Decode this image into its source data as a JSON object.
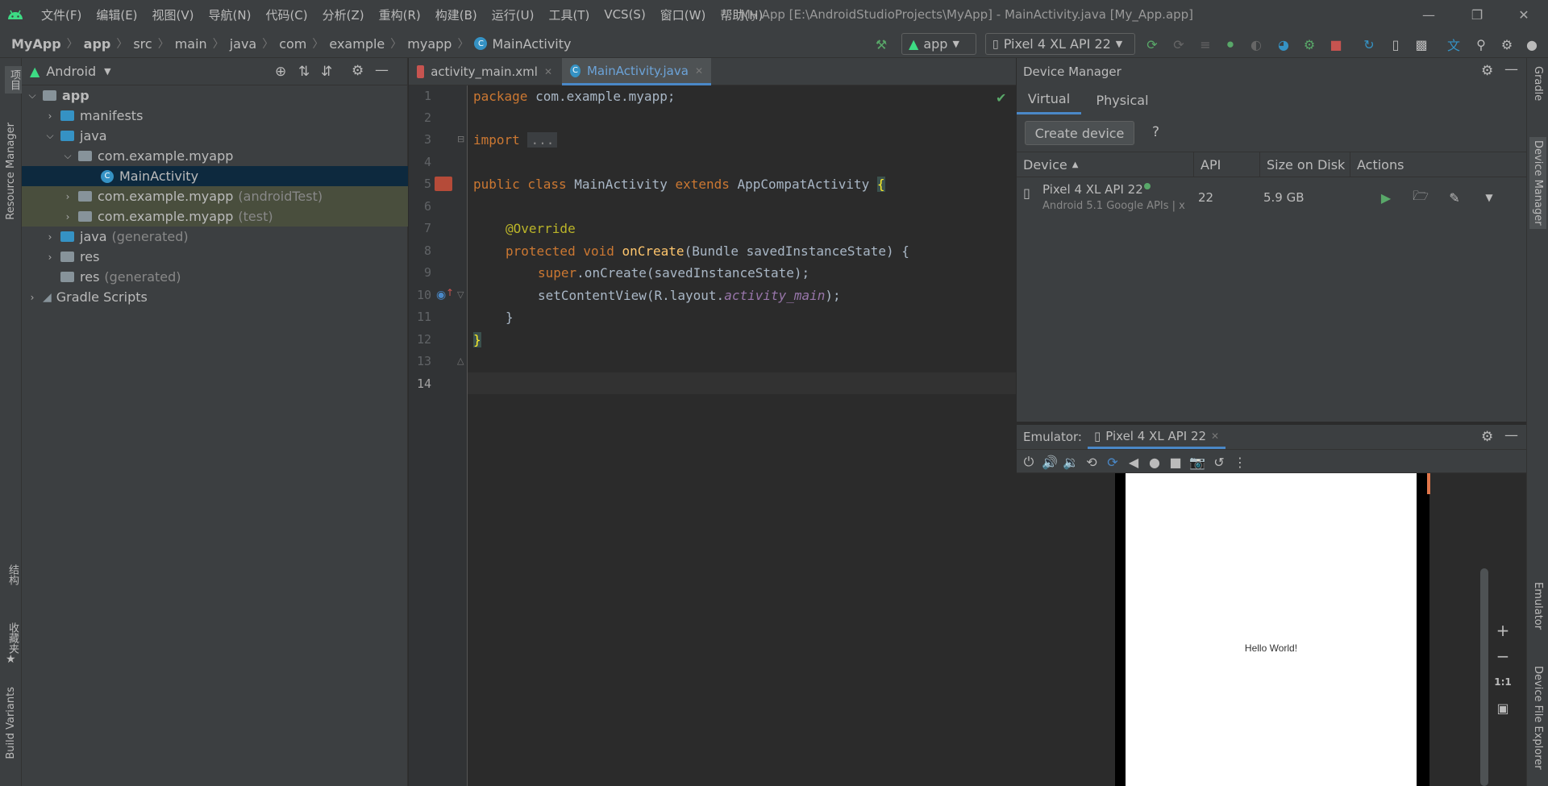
{
  "window": {
    "title": "My App [E:\\AndroidStudioProjects\\MyApp] - MainActivity.java [My_App.app]",
    "menu": [
      "文件(F)",
      "编辑(E)",
      "视图(V)",
      "导航(N)",
      "代码(C)",
      "分析(Z)",
      "重构(R)",
      "构建(B)",
      "运行(U)",
      "工具(T)",
      "VCS(S)",
      "窗口(W)",
      "帮助(H)"
    ]
  },
  "breadcrumbs": [
    "MyApp",
    "app",
    "src",
    "main",
    "java",
    "com",
    "example",
    "myapp",
    "MainActivity"
  ],
  "toolbar": {
    "run_config": "app",
    "device": "Pixel 4 XL API 22"
  },
  "left_strip": {
    "project": "项目",
    "resource_manager": "Resource Manager",
    "structure": "结构",
    "favorites": "收藏夹",
    "build_variants": "Build Variants"
  },
  "project_panel": {
    "view_mode": "Android",
    "tree": [
      {
        "label": "app",
        "suffix": ""
      },
      {
        "label": "manifests",
        "suffix": ""
      },
      {
        "label": "java",
        "suffix": ""
      },
      {
        "label": "com.example.myapp",
        "suffix": ""
      },
      {
        "label": "MainActivity",
        "suffix": ""
      },
      {
        "label": "com.example.myapp",
        "suffix": "(androidTest)"
      },
      {
        "label": "com.example.myapp",
        "suffix": "(test)"
      },
      {
        "label": "java",
        "suffix": "(generated)"
      },
      {
        "label": "res",
        "suffix": ""
      },
      {
        "label": "res",
        "suffix": "(generated)"
      },
      {
        "label": "Gradle Scripts",
        "suffix": ""
      }
    ]
  },
  "editor": {
    "tabs": [
      {
        "label": "activity_main.xml",
        "active": false
      },
      {
        "label": "MainActivity.java",
        "active": true
      }
    ],
    "line_numbers": [
      "1",
      "2",
      "3",
      "4",
      "5",
      "6",
      "7",
      "8",
      "9",
      "10",
      "11",
      "12",
      "13",
      "14"
    ],
    "code": {
      "l1_kw": "package",
      "l1_rest": " com.example.myapp;",
      "l3_kw": "import",
      "l3_fold": "...",
      "l5_kw": "public class",
      "l5_name": " MainActivity ",
      "l5_ext": "extends",
      "l5_base": " AppCompatActivity ",
      "l5_brace": "{",
      "l7_ann": "@Override",
      "l8_kw": "protected void",
      "l8_fn": "onCreate",
      "l8_rest": "(Bundle savedInstanceState) {",
      "l9_kw": "super",
      "l9_rest": ".onCreate(savedInstanceState);",
      "l10_a": "setContentView(R.layout.",
      "l10_it": "activity_main",
      "l10_b": ");",
      "l11": "}",
      "l12": "}"
    }
  },
  "device_manager": {
    "title": "Device Manager",
    "tabs": [
      "Virtual",
      "Physical"
    ],
    "create_button": "Create device",
    "help": "?",
    "columns": [
      "Device",
      "API",
      "Size on Disk",
      "Actions"
    ],
    "devices": [
      {
        "name": "Pixel 4 XL API 22",
        "subtitle": "Android 5.1 Google APIs | x",
        "api": "22",
        "size": "5.9 GB"
      }
    ]
  },
  "emulator": {
    "label": "Emulator:",
    "tab": "Pixel 4 XL API 22",
    "screen_text": "Hello World!",
    "zoom_reset": "1:1"
  },
  "right_strip": {
    "gradle": "Gradle",
    "device_manager": "Device Manager",
    "emulator": "Emulator",
    "device_file_explorer": "Device File Explorer"
  },
  "colors": {
    "accent": "#4a88c7",
    "run_green": "#59a869",
    "stop_red": "#c75450",
    "android_green": "#3ddc84"
  }
}
